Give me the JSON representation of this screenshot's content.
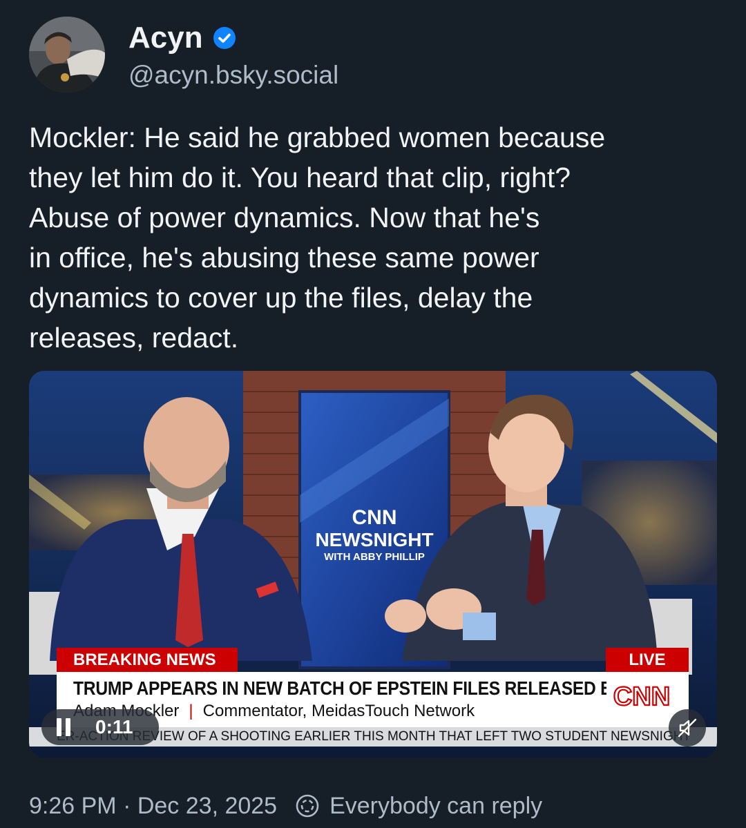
{
  "author": {
    "display_name": "Acyn",
    "handle": "@acyn.bsky.social",
    "verified": true
  },
  "post": {
    "lines": [
      "Mockler: He said he grabbed women because",
      "they let him do it. You heard that clip, right?",
      "Abuse of power dynamics. Now that he's",
      "in office, he's abusing these same power",
      "dynamics to cover up the files, delay the",
      "releases, redact."
    ]
  },
  "video": {
    "show_logo": {
      "network": "CNN",
      "title": "NEWSNIGHT",
      "subtitle": "WITH ABBY PHILLIP"
    },
    "breaking_label": "BREAKING NEWS",
    "live_label": "LIVE",
    "headline": "TRUMP APPEARS IN NEW BATCH OF EPSTEIN FILES RELEASED BY DOJ",
    "speaker_name": "Adam Mockler",
    "speaker_title": "Commentator, MeidasTouch Network",
    "ticker": "ER-ACTION REVIEW OF A SHOOTING EARLIER THIS MONTH THAT LEFT TWO STUDENT NEWSNIGHT",
    "bug_text": "CNN",
    "time": "0:11",
    "state": "playing",
    "muted": true
  },
  "meta": {
    "timestamp": "9:26 PM · Dec 23, 2025",
    "reply_setting": "Everybody can reply"
  },
  "colors": {
    "background": "#161e27",
    "text_primary": "#f1f3f5",
    "text_secondary": "#aebbc9",
    "verified_badge": "#1083fe",
    "cnn_red": "#cc0000"
  }
}
